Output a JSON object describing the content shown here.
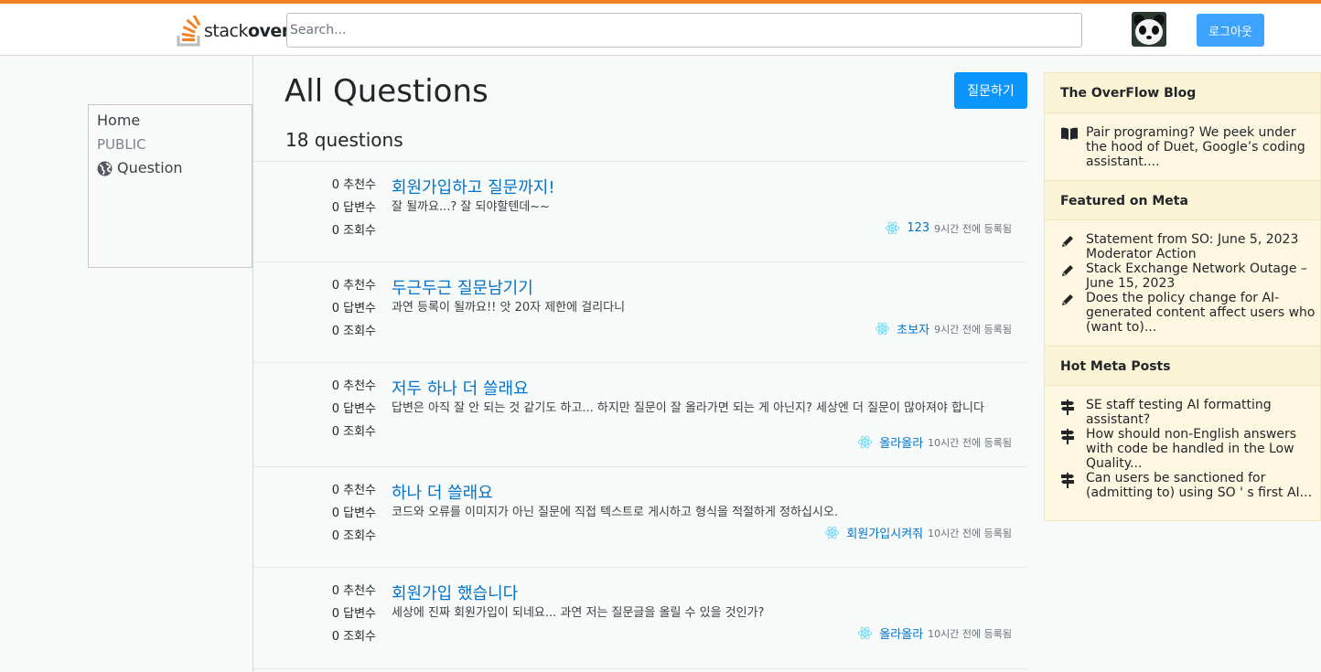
{
  "header": {
    "logo_text_light": "stack",
    "logo_text_bold": "over",
    "search_placeholder": "Search...",
    "logout_label": "로그아웃",
    "accent_color": "#f48225"
  },
  "leftnav": {
    "home": "Home",
    "section": "PUBLIC",
    "question": "Question"
  },
  "main": {
    "title": "All Questions",
    "ask_label": "질문하기",
    "count": "18 questions",
    "questions": [
      {
        "votes": "0 추천수",
        "answers": "0 답변수",
        "views": "0 조회수",
        "title": "회원가입하고 질문까지!",
        "excerpt": "잘 될까요...? 잘 되야할텐데~~",
        "author": "123",
        "time": "9시간 전에 등록됨"
      },
      {
        "votes": "0 추천수",
        "answers": "0 답변수",
        "views": "0 조회수",
        "title": "두근두근 질문남기기",
        "excerpt": "과연 등록이 될까요!! 앗 20자 제한에 걸리다니",
        "author": "초보자",
        "time": "9시간 전에 등록됨"
      },
      {
        "votes": "0 추천수",
        "answers": "0 답변수",
        "views": "0 조회수",
        "title": "저두 하나 더 쓸래요",
        "excerpt": "답변은 아직 잘 안 되는 것 같기도 하고... 하지만 질문이 잘 올라가면 되는 게 아닌지? 세상엔 더 질문이 많아져야 합니다",
        "author": "올라올라",
        "time": "10시간 전에 등록됨"
      },
      {
        "votes": "0 추천수",
        "answers": "0 답변수",
        "views": "0 조회수",
        "title": "하나 더 쓸래요",
        "excerpt": "코드와 오류를 이미지가 아닌 질문에 직접 텍스트로 게시하고 형식을 적절하게 정하십시오.",
        "author": "회원가입시켜줘",
        "time": "10시간 전에 등록됨"
      },
      {
        "votes": "0 추천수",
        "answers": "0 답변수",
        "views": "0 조회수",
        "title": "회원가입 했습니다",
        "excerpt": "세상에 진짜 회원가입이 되네요... 과연 저는 질문글을 올릴 수 있을 것인가?",
        "author": "올라올라",
        "time": "10시간 전에 등록됨"
      }
    ]
  },
  "sidebar": {
    "blog_title": "The OverFlow Blog",
    "blog_items": [
      "Pair programing? We peek under the hood of Duet, Google’s coding assistant...."
    ],
    "meta_title": "Featured on Meta",
    "meta_items": [
      "Statement from SO: June 5, 2023 Moderator Action",
      "Stack Exchange Network Outage – June 15, 2023",
      "Does the policy change for AI-generated content affect users who (want to)..."
    ],
    "hot_title": "Hot Meta Posts",
    "hot_items": [
      "SE staff testing AI formatting assistant?",
      "How should non-English answers with code be handled in the Low Quality...",
      "Can users be sanctioned for (admitting to) using SO ' s first AI..."
    ]
  }
}
